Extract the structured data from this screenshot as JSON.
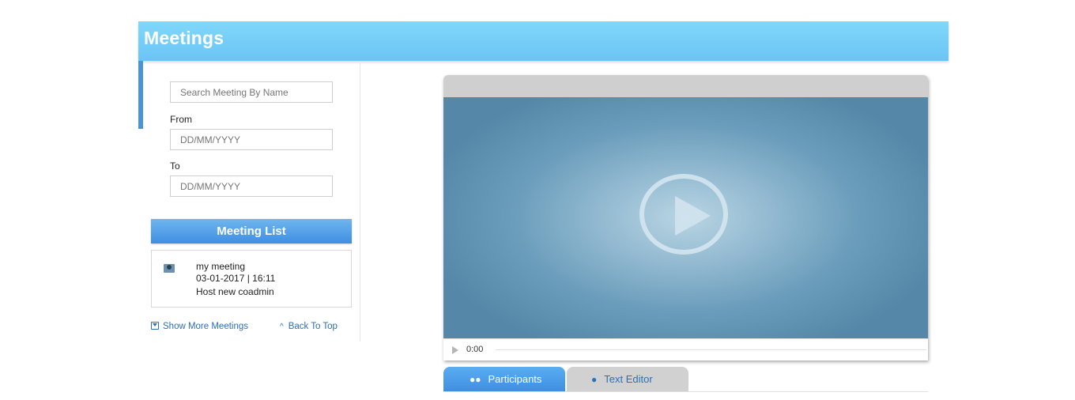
{
  "header": {
    "title": "Meetings"
  },
  "filters": {
    "search_placeholder": "Search Meeting By Name",
    "from_label": "From",
    "from_placeholder": "DD/MM/YYYY",
    "to_label": "To",
    "to_placeholder": "DD/MM/YYYY"
  },
  "meeting_list": {
    "header": "Meeting List",
    "items": [
      {
        "name": "my meeting",
        "datetime": "03-01-2017 | 16:11",
        "host": "Host new coadmin"
      }
    ],
    "show_more_label": "Show More Meetings",
    "back_to_top_label": "Back To Top"
  },
  "player": {
    "time": "0:00"
  },
  "tabs": [
    {
      "label": "Participants",
      "icon": "users-icon",
      "active": true
    },
    {
      "label": "Text Editor",
      "icon": "chat-bubble-icon",
      "active": false
    }
  ],
  "colors": {
    "header": "#7fd8fb",
    "accent": "#3f8ee2",
    "link": "#2d6eb8"
  }
}
